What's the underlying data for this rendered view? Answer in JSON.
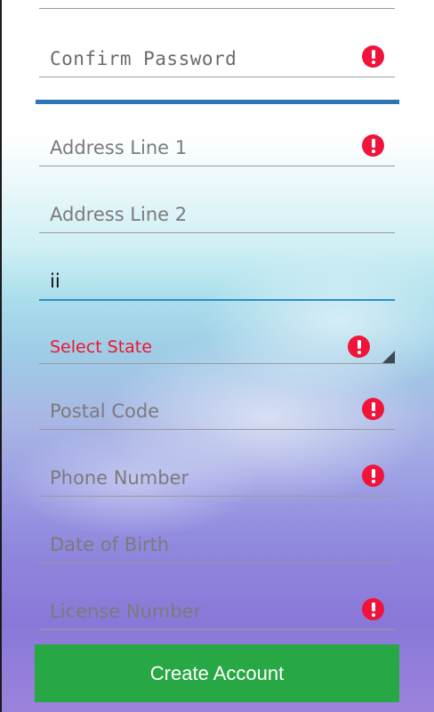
{
  "form": {
    "confirm_password": {
      "placeholder": "Confirm Password"
    },
    "address_line_1": {
      "placeholder": "Address Line 1"
    },
    "address_line_2": {
      "placeholder": "Address Line 2"
    },
    "city": {
      "value": "ii"
    },
    "state": {
      "placeholder": "Select State"
    },
    "postal_code": {
      "placeholder": "Postal Code"
    },
    "phone_number": {
      "placeholder": "Phone Number"
    },
    "date_of_birth": {
      "placeholder": "Date of Birth"
    },
    "license_number": {
      "placeholder": "License Number"
    }
  },
  "actions": {
    "create_account_label": "Create Account"
  },
  "colors": {
    "error": "#f0143c",
    "active_underline": "#2a8fc4",
    "section_divider": "#2c76b8",
    "button": "#28a745"
  }
}
